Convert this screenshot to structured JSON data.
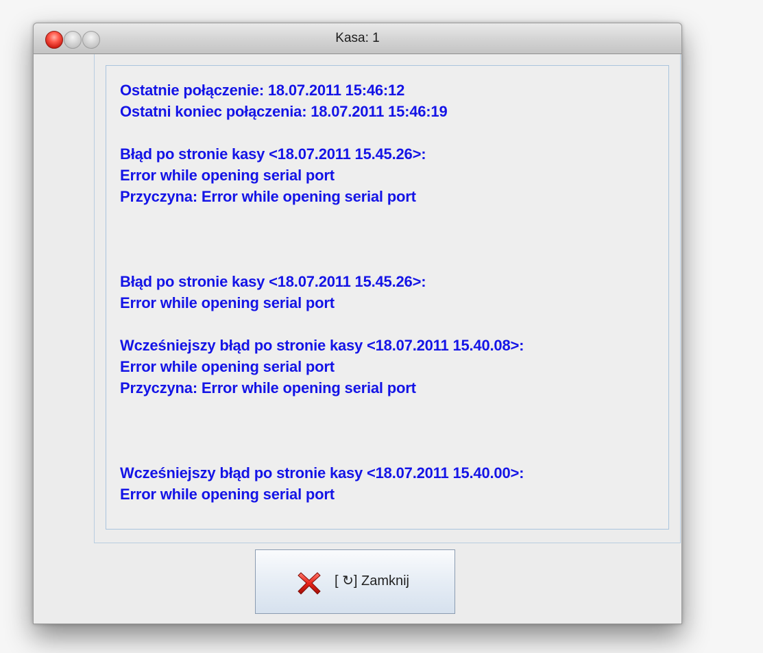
{
  "window": {
    "title": "Kasa: 1"
  },
  "messages": [
    "Ostatnie połączenie: 18.07.2011 15:46:12",
    "Ostatni koniec połączenia: 18.07.2011 15:46:19",
    "",
    "Błąd po stronie kasy <18.07.2011 15.45.26>:",
    "Error while opening serial port",
    "Przyczyna: Error while opening serial port",
    "",
    "",
    "",
    "Błąd po stronie kasy <18.07.2011 15.45.26>:",
    "Error while opening serial port",
    "",
    "Wcześniejszy błąd po stronie kasy <18.07.2011 15.40.08>:",
    "Error while opening serial port",
    "Przyczyna: Error while opening serial port",
    "",
    "",
    "",
    "Wcześniejszy błąd po stronie kasy <18.07.2011 15.40.00>:",
    "Error while opening serial port"
  ],
  "buttons": {
    "close_label": "[ ↻] Zamknij",
    "close_icon": "red-x-icon"
  },
  "colors": {
    "message_text": "#1414e6",
    "close_icon": "#e8231a"
  }
}
